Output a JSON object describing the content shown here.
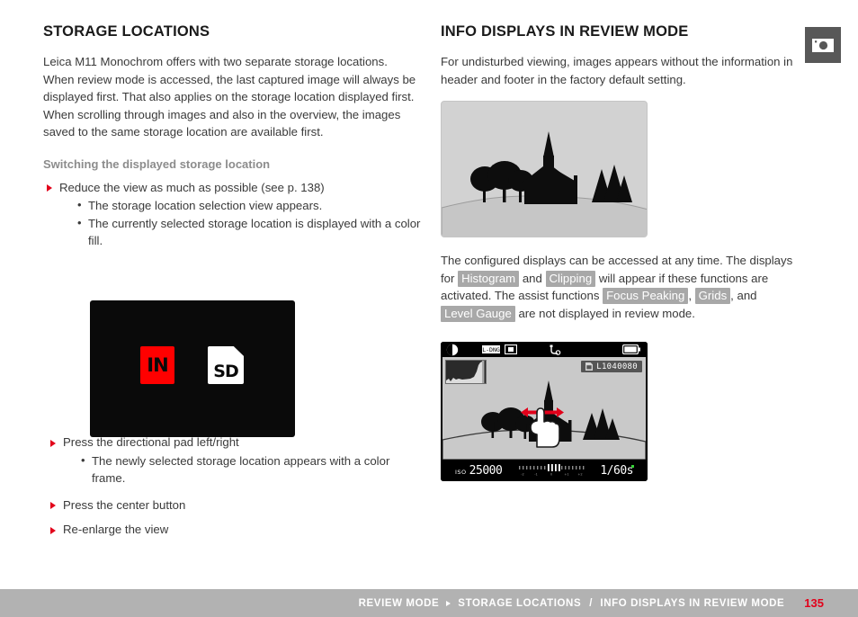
{
  "left_column": {
    "title": "STORAGE LOCATIONS",
    "paragraphs": [
      "Leica M11 Monochrom offers with two separate storage locations.",
      "When review mode is accessed, the last captured image will always be displayed first. That also applies on the storage location displayed first.",
      "When scrolling through images and also in the overview, the images saved to the same storage location are available first."
    ],
    "subheading": "Switching the displayed storage location",
    "steps_top": [
      {
        "text": "Reduce the view as much as possible (see p. 138)",
        "subs": [
          "The storage location selection view appears.",
          "The currently selected storage location is displayed with a color fill."
        ]
      }
    ],
    "steps_bottom": [
      {
        "text": "Press the directional pad left/right",
        "subs": [
          "The newly selected storage location appears with a color frame."
        ]
      },
      {
        "text": "Press the center button",
        "subs": []
      },
      {
        "text": "Re-enlarge the view",
        "subs": []
      }
    ],
    "storage_figure": {
      "internal_label": "IN",
      "sd_label": "SD",
      "internal_color": "#ff0000",
      "sd_color": "#ffffff",
      "background": "#0a0a0a"
    }
  },
  "right_column": {
    "title": "INFO DISPLAYS IN REVIEW MODE",
    "intro": "For undisturbed viewing, images appears without the information in header and footer in the factory default setting.",
    "landscape_caption": "",
    "mid_paragraph": {
      "part1": "The configured displays can be accessed at any time. The displays for ",
      "hl1": "Histogram",
      "part2": " and ",
      "hl2": "Clipping",
      "part3": " will appear if these functions are activated. The assist functions ",
      "hl3": "Focus Peaking",
      "part4": ", ",
      "hl4": "Grids",
      "part5": ", and ",
      "hl5": "Level Gauge",
      "part6": " are not displayed in review mode."
    },
    "camera_screen": {
      "file_number": "L1040080",
      "iso_label": "ISO",
      "iso_value": "25000",
      "shutter_speed": "1/60s",
      "exposure_scale": [
        "-2",
        "-1",
        "0",
        "+1",
        "+2"
      ],
      "icons": {
        "mode": "half-moon-icon",
        "dng": "dng-format-icon",
        "metering": "spot-metering-icon",
        "lens": "lens-detection-icon",
        "battery": "battery-icon",
        "card": "sd-card-icon"
      },
      "gesture": "swipe-left-right-hand-icon"
    }
  },
  "app_icon": {
    "name": "camera-icon",
    "background": "#585858"
  },
  "footer": {
    "crumb1": "REVIEW MODE",
    "crumb2": "STORAGE LOCATIONS",
    "crumb3": "INFO DISPLAYS IN REVIEW MODE",
    "separator": "/",
    "page_number": "135",
    "accent_color": "#e2001a",
    "bar_color": "#b2b2b2"
  }
}
